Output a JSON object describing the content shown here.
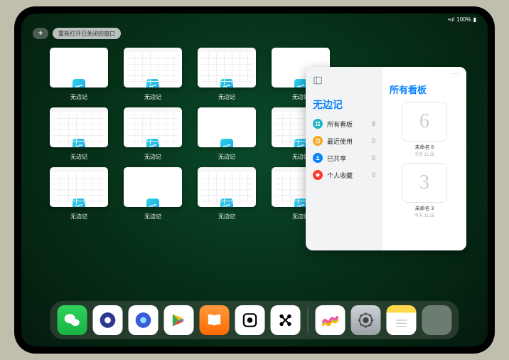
{
  "status": {
    "signal": "•ııl",
    "wifi": "100%",
    "battery": "▮"
  },
  "topControls": {
    "plus": "+",
    "reopen": "重新打开已关闭的窗口"
  },
  "app_name": "无边记",
  "windows": [
    {
      "variant": "blank"
    },
    {
      "variant": "cal"
    },
    {
      "variant": "cal"
    },
    {
      "variant": "blank"
    },
    {
      "variant": "cal"
    },
    {
      "variant": "cal"
    },
    {
      "variant": "blank"
    },
    {
      "variant": "cal"
    },
    {
      "variant": "cal"
    },
    {
      "variant": "blank"
    },
    {
      "variant": "cal"
    },
    {
      "variant": "cal"
    }
  ],
  "panel": {
    "left_title": "无边记",
    "right_title": "所有看板",
    "more": "···",
    "items": [
      {
        "color": "#1fb6c7",
        "icon": "grid",
        "label": "所有看板",
        "count": "8"
      },
      {
        "color": "#f5a623",
        "icon": "clock",
        "label": "最近使用",
        "count": "0"
      },
      {
        "color": "#0a84ff",
        "icon": "share",
        "label": "已共享",
        "count": "0"
      },
      {
        "color": "#ff3b30",
        "icon": "heart",
        "label": "个人收藏",
        "count": "0"
      }
    ],
    "boards": [
      {
        "glyph": "6",
        "name": "未命名 6",
        "date": "今天 11:28"
      },
      {
        "glyph": "3",
        "name": "未命名 3",
        "date": "今天 11:25"
      }
    ]
  },
  "dock": [
    {
      "name": "wechat",
      "bg": "bg-wechat"
    },
    {
      "name": "quark-hd",
      "bg": "bg-white"
    },
    {
      "name": "quark",
      "bg": "bg-white"
    },
    {
      "name": "play",
      "bg": "bg-white"
    },
    {
      "name": "books",
      "bg": "bg-books"
    },
    {
      "name": "dice",
      "bg": "bg-white"
    },
    {
      "name": "dots",
      "bg": "bg-white"
    },
    {
      "name": "sep"
    },
    {
      "name": "freeform",
      "bg": "bg-white"
    },
    {
      "name": "settings",
      "bg": "bg-settings"
    },
    {
      "name": "notes",
      "bg": "bg-notes"
    },
    {
      "name": "folder",
      "bg": "bg-folder"
    }
  ]
}
